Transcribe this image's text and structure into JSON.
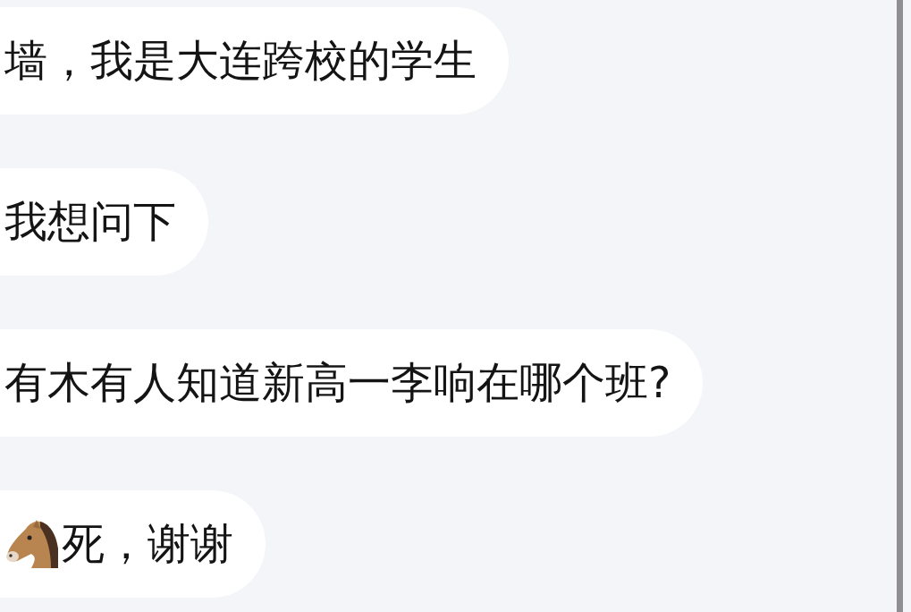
{
  "messages": [
    {
      "kind": "text",
      "text": "墙，我是大连跨校的学生"
    },
    {
      "kind": "text",
      "text": "我想问下"
    },
    {
      "kind": "text",
      "text": "有木有人知道新高一李响在哪个班?"
    },
    {
      "kind": "horse",
      "text": "死，谢谢"
    }
  ]
}
